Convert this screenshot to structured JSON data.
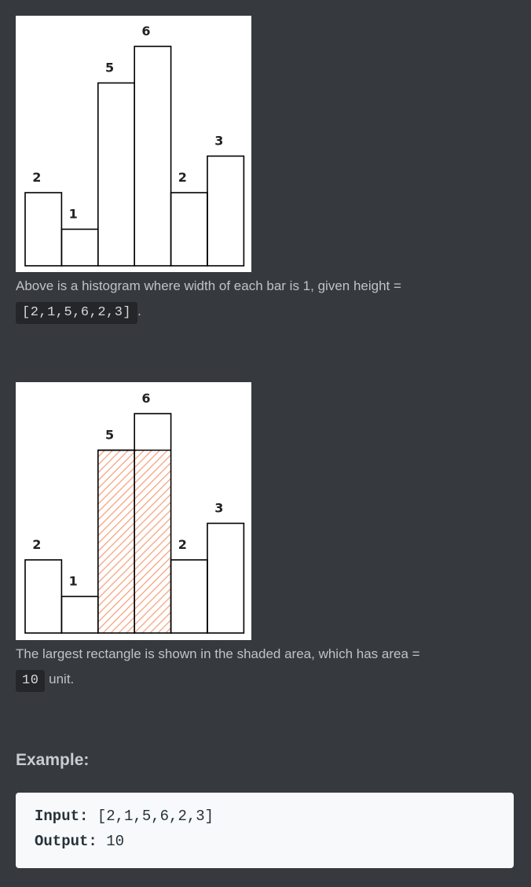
{
  "histogram": {
    "heights": [
      2,
      1,
      5,
      6,
      2,
      3
    ],
    "unit_scale": 1,
    "highlight": {
      "start_index": 2,
      "end_index": 3,
      "height": 5,
      "hatch_color": "#f4a37f"
    },
    "labels": [
      "2",
      "1",
      "5",
      "6",
      "2",
      "3"
    ]
  },
  "description1": {
    "text_before": "Above is a histogram where width of each bar is 1, given height = ",
    "code": "[2,1,5,6,2,3]",
    "text_after": "."
  },
  "description2": {
    "text_before": "The largest rectangle is shown in the shaded area, which has area = ",
    "code": "10",
    "text_after": " unit."
  },
  "example": {
    "heading": "Example:",
    "input_label": "Input:",
    "input_value": "[2,1,5,6,2,3]",
    "output_label": "Output:",
    "output_value": "10"
  },
  "colors": {
    "background": "#36393e",
    "text": "#bfc3c9",
    "code_bg": "#24262a",
    "example_bg": "#f7f9fa",
    "hatch": "#f4a37f"
  }
}
